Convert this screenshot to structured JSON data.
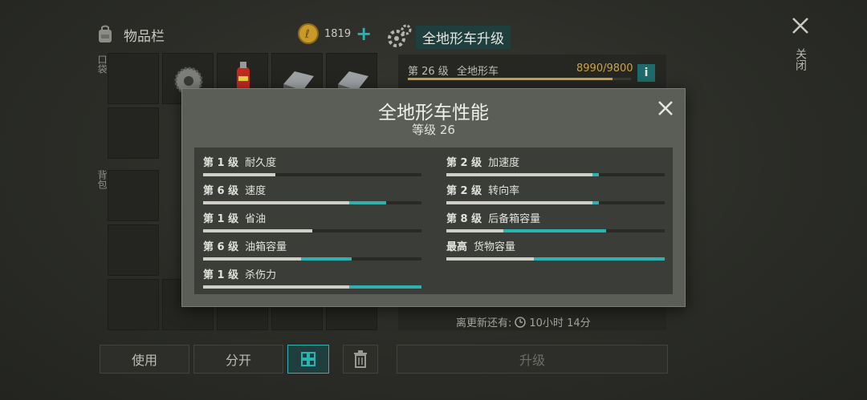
{
  "inventory": {
    "title": "物品栏",
    "pocket_label": "口袋",
    "backpack_label": "背包",
    "coins": "1819",
    "buttons": {
      "use": "使用",
      "split": "分开"
    }
  },
  "vehicle": {
    "title": "全地形车升级",
    "level_text": "第 26 级",
    "name": "全地形车",
    "xp": "8990/9800",
    "xp_fraction": 0.917,
    "info": "i",
    "close_label": "关闭",
    "refresh_label": "离更新还有:",
    "refresh_time": "10小时 14分",
    "upgrade_label": "升级"
  },
  "modal": {
    "title": "全地形车性能",
    "subtitle": "等级 26",
    "stats": [
      {
        "level": "第 1 级",
        "name": "耐久度",
        "base": 0.33,
        "upgrade": 0
      },
      {
        "level": "第 2 级",
        "name": "加速度",
        "base": 0.67,
        "upgrade": 0.03
      },
      {
        "level": "第 6 级",
        "name": "速度",
        "base": 0.67,
        "upgrade": 0.17
      },
      {
        "level": "第 2 级",
        "name": "转向率",
        "base": 0.67,
        "upgrade": 0.03
      },
      {
        "level": "第 1 级",
        "name": "省油",
        "base": 0.5,
        "upgrade": 0
      },
      {
        "level": "第 8 级",
        "name": "后备箱容量",
        "base": 0.26,
        "upgrade": 0.47
      },
      {
        "level": "第 6 级",
        "name": "油箱容量",
        "base": 0.45,
        "upgrade": 0.23
      },
      {
        "level": "最高",
        "name": "货物容量",
        "base": 0.4,
        "upgrade": 0.6
      },
      {
        "level": "第 1 级",
        "name": "杀伤力",
        "base": 0.67,
        "upgrade": 0.33
      }
    ]
  },
  "colors": {
    "accent": "#2ab3b1",
    "gold": "#c9a34a",
    "panel": "#5b5d57"
  }
}
